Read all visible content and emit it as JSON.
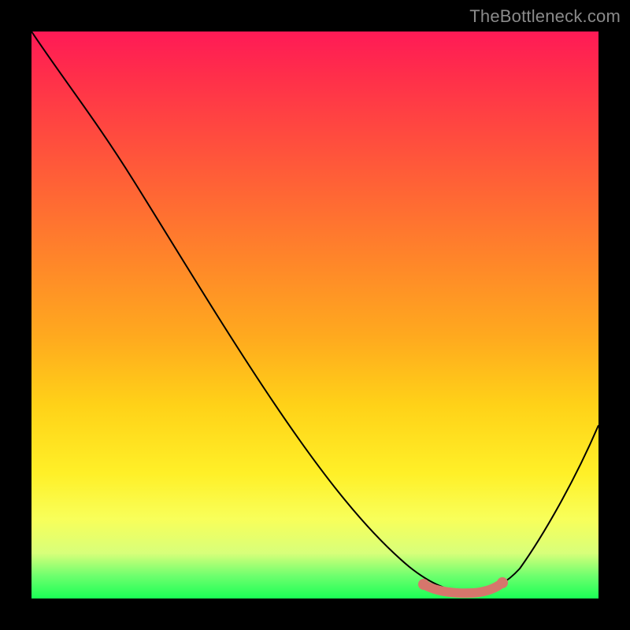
{
  "watermark": {
    "text": "TheBottleneck.com"
  },
  "chart_data": {
    "type": "line",
    "title": "",
    "xlabel": "",
    "ylabel": "",
    "xlim": [
      0,
      100
    ],
    "ylim": [
      0,
      100
    ],
    "grid": false,
    "x": [
      0,
      5,
      10,
      15,
      20,
      25,
      30,
      35,
      40,
      45,
      50,
      55,
      60,
      65,
      70,
      72,
      75,
      78,
      80,
      82,
      85,
      88,
      92,
      96,
      100
    ],
    "values": [
      100,
      94,
      88,
      80,
      73,
      65,
      57,
      49,
      41,
      33,
      25,
      18,
      12,
      7,
      3,
      2,
      1,
      1,
      1,
      2,
      4,
      9,
      15,
      22,
      30
    ],
    "trough": {
      "x_start": 70,
      "x_end": 82,
      "y_approx": 1.5,
      "marker_color": "#d6766c"
    },
    "background_gradient": {
      "top_color": "#ff1a56",
      "bottom_color": "#1aff55"
    }
  }
}
